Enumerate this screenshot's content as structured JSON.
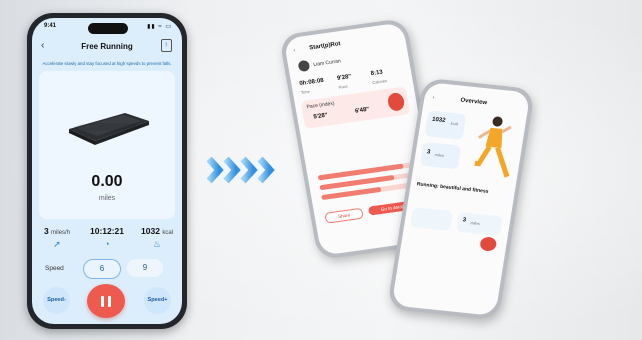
{
  "main_phone": {
    "status_time": "9:41",
    "status_icons": "▮▮ ≈ ▭",
    "back_icon": "‹",
    "title": "Free Running",
    "bluetooth_icon": "bluetooth-icon",
    "tip": "Accelerate slowly and stay focused at high speeds to prevent falls.",
    "distance_value": "0.00",
    "distance_unit": "miles",
    "stats": [
      {
        "value": "3",
        "unit": "miles/h",
        "icon": "speed-arrow-icon"
      },
      {
        "value": "10:12:21",
        "unit": "",
        "icon": "timer-icon"
      },
      {
        "value": "1032",
        "unit": "kcal",
        "icon": "flame-icon"
      }
    ],
    "speed_label": "Speed",
    "speed_options": [
      "6",
      "9"
    ],
    "speed_minus_label": "Speed-",
    "speed_plus_label": "Speed+",
    "pause_icon": "pause-icon",
    "accent_color": "#ef5a4e",
    "screen_color": "#dceefb"
  },
  "phone_left": {
    "title": "Start(p)Rot",
    "user": "Liam Curran",
    "stats_row": [
      "0h:08:08",
      "9'28\"",
      "8:13"
    ],
    "stats_labels": [
      "Time",
      "Pace",
      "Calories"
    ],
    "section": "Pace (index)",
    "pace_values": [
      "5'28\"",
      "6'48\""
    ],
    "bars": [
      0.9,
      0.78,
      0.62
    ],
    "buttons": [
      "Share",
      "Go to details"
    ]
  },
  "phone_right": {
    "title": "Overview",
    "stat_value": "1032",
    "stat_unit": "kcal",
    "stat2_value": "3",
    "stat2_unit": "miles",
    "banner": "Running: beautiful and fitness",
    "stat3_value": "3",
    "stat3_unit": "miles"
  }
}
